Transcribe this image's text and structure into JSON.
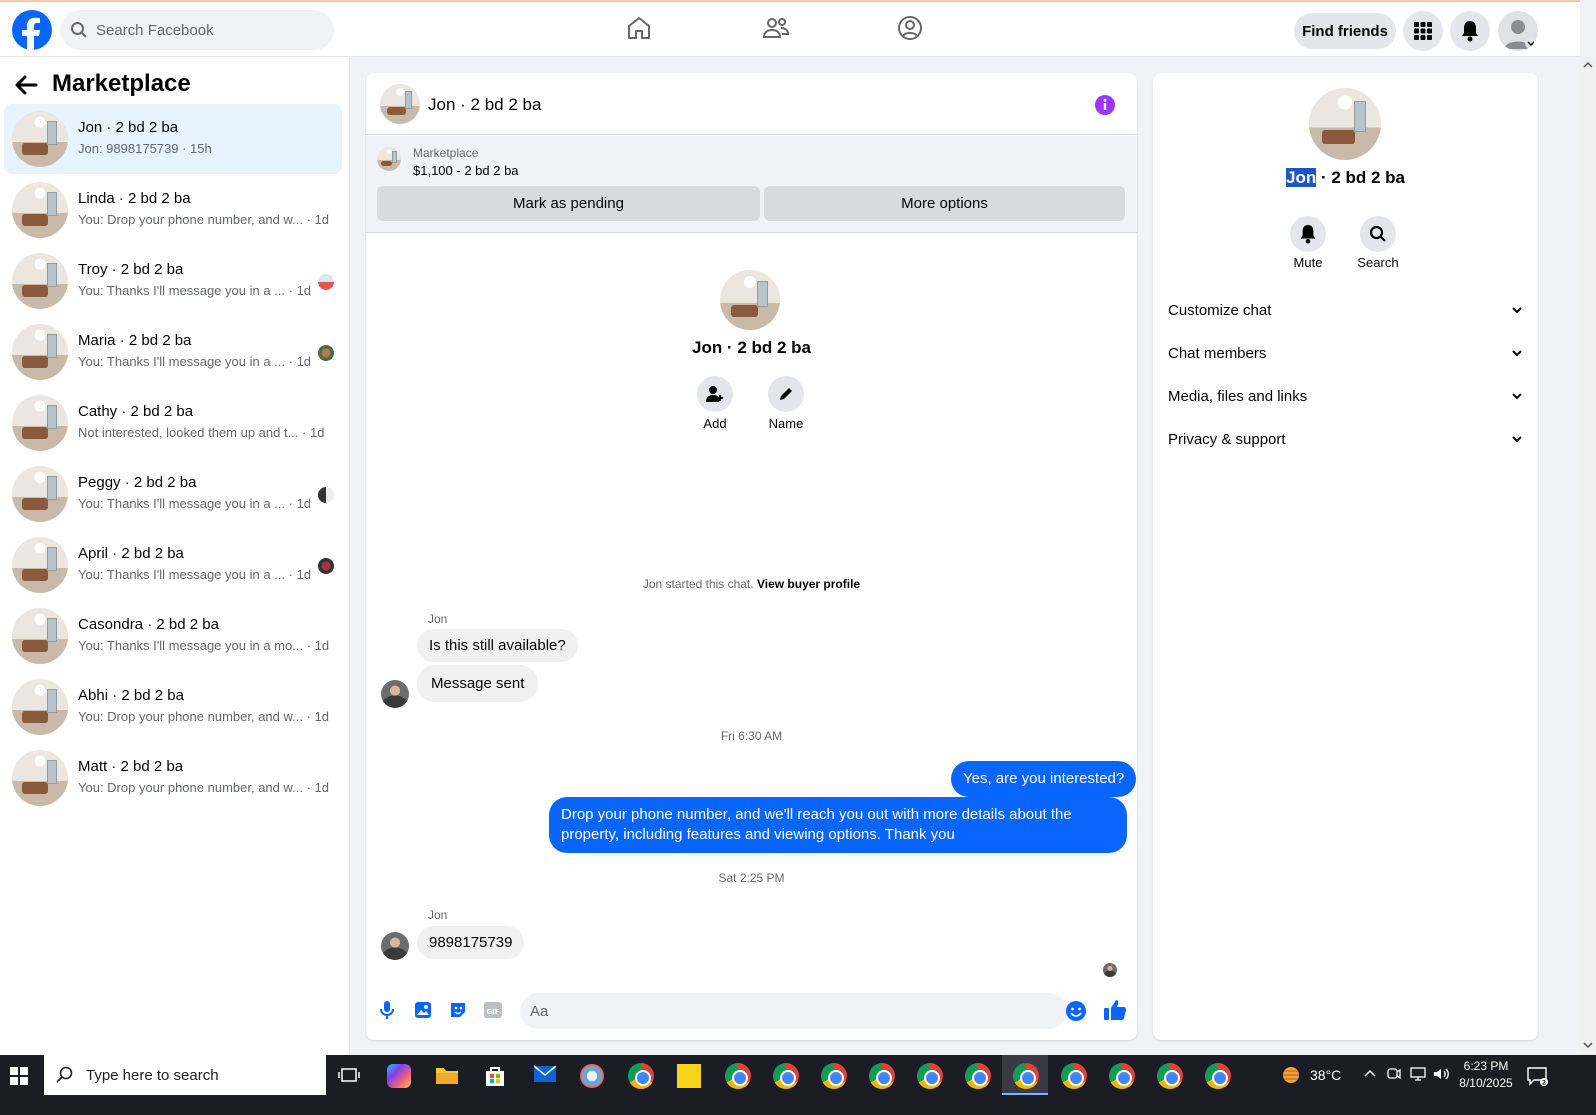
{
  "topbar": {
    "search_placeholder": "Search Facebook",
    "find_friends": "Find friends"
  },
  "sidebar": {
    "title": "Marketplace",
    "conversations": [
      {
        "name": "Jon · 2 bd 2 ba",
        "preview": "Jon: 9898175739 · 15h",
        "time": ""
      },
      {
        "name": "Linda · 2 bd 2 ba",
        "preview": "You: Drop your phone number, and w...",
        "time": "· 1d"
      },
      {
        "name": "Troy · 2 bd 2 ba",
        "preview": "You: Thanks I'll message you in a ...",
        "time": "· 1d"
      },
      {
        "name": "Maria · 2 bd 2 ba",
        "preview": "You: Thanks I'll message you in a ...",
        "time": "· 1d"
      },
      {
        "name": "Cathy · 2 bd 2 ba",
        "preview": "Not interested, looked them up and t...",
        "time": "· 1d"
      },
      {
        "name": "Peggy · 2 bd 2 ba",
        "preview": "You: Thanks I'll message you in a ...",
        "time": "· 1d"
      },
      {
        "name": "April · 2 bd 2 ba",
        "preview": "You: Thanks I'll message you in a ...",
        "time": "· 1d"
      },
      {
        "name": "Casondra · 2 bd 2 ba",
        "preview": "You: Thanks I'll message you in a mo...",
        "time": "· 1d"
      },
      {
        "name": "Abhi · 2 bd 2 ba",
        "preview": "You: Drop your phone number, and w...",
        "time": "· 1d"
      },
      {
        "name": "Matt · 2 bd 2 ba",
        "preview": "You: Drop your phone number, and w...",
        "time": "· 1d"
      }
    ]
  },
  "chat": {
    "header_title": "Jon · 2 bd 2 ba",
    "listing_source": "Marketplace",
    "listing_title": "$1,100 - 2 bd 2 ba",
    "mark_pending": "Mark as pending",
    "more_options": "More options",
    "profile_name": "Jon · 2 bd 2 ba",
    "add_label": "Add",
    "name_label": "Name",
    "started_text": "Jon started this chat.",
    "view_buyer": "View buyer profile",
    "sender_name": "Jon",
    "msg1": "Is this still available?",
    "msg2": "Message sent",
    "stamp1": "Fri 6:30 AM",
    "out1": "Yes, are you interested?",
    "out2": "Drop your phone number, and we'll reach you out with more details about the property, including features and viewing options.  Thank you",
    "stamp2": "Sat 2:25 PM",
    "sender_name2": "Jon",
    "msg3": "9898175739",
    "composer_placeholder": "Aa"
  },
  "right": {
    "name_highlight": "Jon",
    "name_rest": " · 2 bd 2 ba",
    "mute": "Mute",
    "search": "Search",
    "sections": [
      "Customize chat",
      "Chat members",
      "Media, files and links",
      "Privacy & support"
    ]
  },
  "taskbar": {
    "search_placeholder": "Type here to search",
    "weather": "38°C",
    "time": "6:23 PM",
    "date": "8/10/2025"
  },
  "colors": {
    "accent": "#0866ff",
    "info": "#a033ff"
  }
}
